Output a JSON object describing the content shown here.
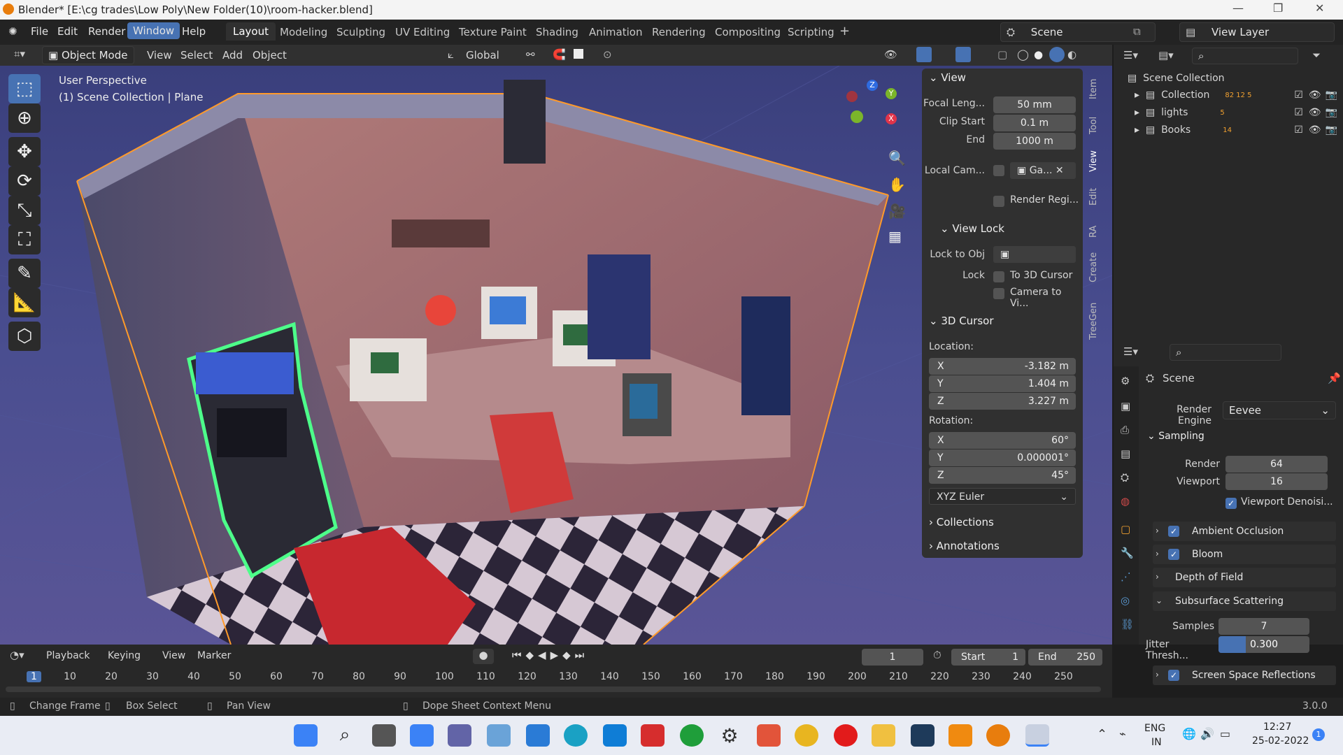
{
  "title_bar": {
    "title": "Blender* [E:\\cg trades\\Low Poly\\New Folder(10)\\room-hacker.blend]"
  },
  "menu": {
    "items": [
      "File",
      "Edit",
      "Render",
      "Window",
      "Help"
    ],
    "active": "Window"
  },
  "workspaces": {
    "items": [
      "Layout",
      "Modeling",
      "Sculpting",
      "UV Editing",
      "Texture Paint",
      "Shading",
      "Animation",
      "Rendering",
      "Compositing",
      "Scripting"
    ],
    "active": "Layout",
    "add": "+"
  },
  "scene": {
    "label": "Scene"
  },
  "view_layer": {
    "label": "View Layer"
  },
  "viewport_header": {
    "mode": "Object Mode",
    "menus": [
      "View",
      "Select",
      "Add",
      "Object"
    ],
    "transform": "Global"
  },
  "viewport": {
    "perspective": "User Perspective",
    "context": "(1) Scene Collection | Plane",
    "gizmo": {
      "x": "X",
      "y": "Y",
      "z": "Z"
    }
  },
  "npanel": {
    "view": {
      "title": "View",
      "focal_label": "Focal Leng...",
      "focal_value": "50 mm",
      "clip_start_label": "Clip Start",
      "clip_start_value": "0.1 m",
      "end_label": "End",
      "end_value": "1000 m",
      "local_cam_label": "Local Cam...",
      "local_cam_value": "Ga...",
      "render_region": "Render Regi..."
    },
    "view_lock": {
      "title": "View Lock",
      "lock_to_obj": "Lock to Obj",
      "lock": "Lock",
      "to_3d_cursor": "To 3D Cursor",
      "camera_to_view": "Camera to Vi..."
    },
    "cursor": {
      "title": "3D Cursor",
      "location_label": "Location:",
      "loc_x_label": "X",
      "loc_x": "-3.182 m",
      "loc_y_label": "Y",
      "loc_y": "1.404 m",
      "loc_z_label": "Z",
      "loc_z": "3.227 m",
      "rotation_label": "Rotation:",
      "rot_x_label": "X",
      "rot_x": "60°",
      "rot_y_label": "Y",
      "rot_y": "0.000001°",
      "rot_z_label": "Z",
      "rot_z": "45°",
      "rotation_mode": "XYZ Euler"
    },
    "collections": "Collections",
    "annotations": "Annotations"
  },
  "side_tabs": [
    "Item",
    "Tool",
    "View",
    "Edit",
    "RA",
    "Create",
    "TreeGen"
  ],
  "outliner": {
    "root": "Scene Collection",
    "items": [
      {
        "name": "Collection",
        "badges": "82 12 5"
      },
      {
        "name": "lights",
        "badges": "5"
      },
      {
        "name": "Books",
        "badges": "14"
      }
    ]
  },
  "properties": {
    "context": "Scene",
    "render_engine_label": "Render Engine",
    "render_engine": "Eevee",
    "sampling": {
      "title": "Sampling",
      "render_label": "Render",
      "render": "64",
      "viewport_label": "Viewport",
      "viewport": "16",
      "denoise": "Viewport Denoisi..."
    },
    "panels": [
      "Ambient Occlusion",
      "Bloom",
      "Depth of Field",
      "Subsurface Scattering"
    ],
    "sss": {
      "samples_label": "Samples",
      "samples": "7",
      "jitter_label": "Jitter Thresh...",
      "jitter": "0.300"
    },
    "ssr": "Screen Space Reflections"
  },
  "timeline": {
    "menus": [
      "Playback",
      "Keying",
      "View",
      "Marker"
    ],
    "current_frame": "1",
    "start_label": "Start",
    "start": "1",
    "end_label": "End",
    "end": "250",
    "ticks": [
      "1",
      "10",
      "20",
      "30",
      "40",
      "50",
      "60",
      "70",
      "80",
      "90",
      "100",
      "110",
      "120",
      "130",
      "140",
      "150",
      "160",
      "170",
      "180",
      "190",
      "200",
      "210",
      "220",
      "230",
      "240",
      "250"
    ]
  },
  "status_bar": {
    "change_frame": "Change Frame",
    "box_select": "Box Select",
    "pan_view": "Pan View",
    "context_menu": "Dope Sheet Context Menu",
    "version": "3.0.0"
  },
  "taskbar": {
    "lang_top": "ENG",
    "lang_bottom": "IN",
    "time": "12:27",
    "date": "25-02-2022",
    "notif": "1"
  }
}
